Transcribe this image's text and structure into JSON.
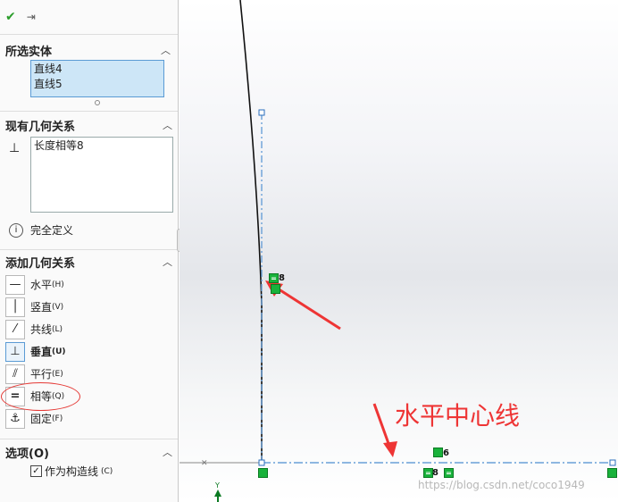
{
  "toolbar": {
    "ok_icon": "check-icon",
    "pin_icon": "pushpin-icon"
  },
  "selected_entities": {
    "title": "所选实体",
    "items": [
      "直线4",
      "直线5"
    ]
  },
  "existing_relations": {
    "title": "现有几何关系",
    "items": [
      "长度相等8"
    ]
  },
  "status": {
    "text": "完全定义"
  },
  "add_relations": {
    "title": "添加几何关系",
    "items": [
      {
        "label": "水平",
        "accel": "(H)",
        "icon": "horizontal-icon"
      },
      {
        "label": "竖直",
        "accel": "(V)",
        "icon": "vertical-icon"
      },
      {
        "label": "共线",
        "accel": "(L)",
        "icon": "collinear-icon"
      },
      {
        "label": "垂直",
        "accel": "(U)",
        "icon": "perpendicular-icon"
      },
      {
        "label": "平行",
        "accel": "(E)",
        "icon": "parallel-icon"
      },
      {
        "label": "相等",
        "accel": "(Q)",
        "icon": "equal-icon"
      },
      {
        "label": "固定",
        "accel": "(F)",
        "icon": "fix-icon"
      }
    ]
  },
  "options": {
    "title": "选项(O)",
    "construction_label": "作为构造线",
    "construction_accel": "(C)",
    "construction_checked": true
  },
  "canvas": {
    "markers": [
      {
        "label": "8"
      },
      {
        "label": "6"
      },
      {
        "label": "8"
      }
    ],
    "annotation": "水平中心线",
    "watermark": "https://blog.csdn.net/coco1949"
  },
  "colors": {
    "annotation": "#ee3535",
    "marker": "#19b23b",
    "selection": "#cde6f7",
    "centerline": "#6aa0d8"
  }
}
